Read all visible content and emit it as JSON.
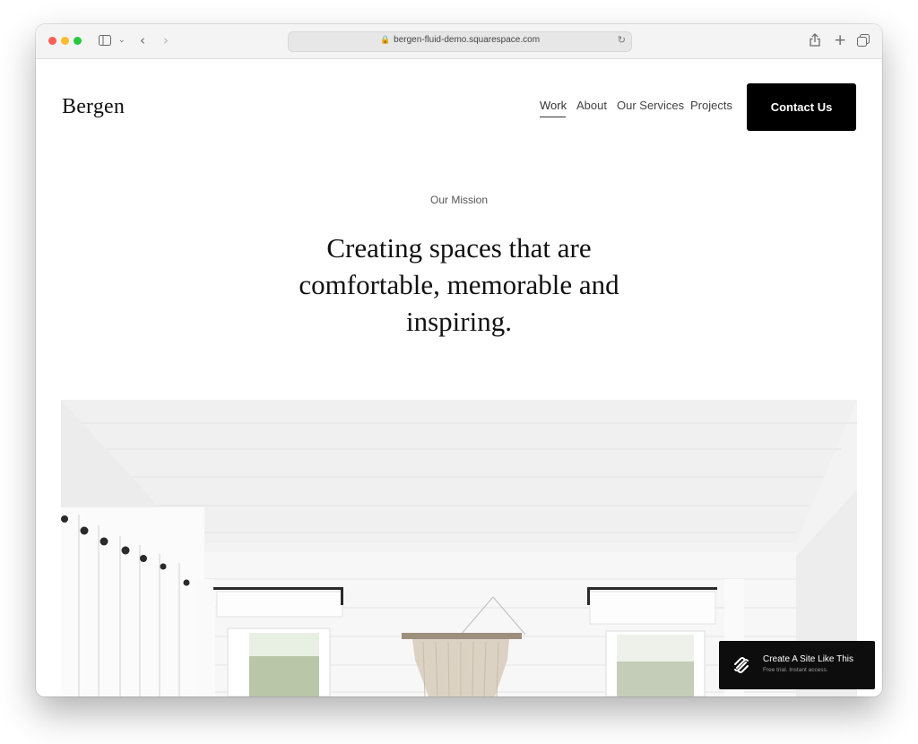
{
  "browser": {
    "url": "bergen-fluid-demo.squarespace.com"
  },
  "site": {
    "logo": "Bergen",
    "nav": [
      "Work",
      "About",
      "Our Services",
      "Projects"
    ],
    "cta": "Contact Us",
    "eyebrow": "Our Mission",
    "headline": [
      "Creating spaces that are",
      "comfortable, memorable and",
      "inspiring."
    ]
  },
  "badge": {
    "title": "Create A Site Like This",
    "subtitle": "Free trial. Instant access."
  },
  "icons": [
    "sidebar-icon",
    "chevron-down-icon",
    "back-arrow-icon",
    "forward-arrow-icon",
    "lock-icon",
    "reload-icon",
    "share-icon",
    "plus-icon",
    "tabs-icon",
    "squarespace-logo-icon"
  ],
  "colors": {
    "cta_bg": "#000000",
    "cta_text": "#ffffff",
    "badge_bg": "#0d0d0d"
  }
}
